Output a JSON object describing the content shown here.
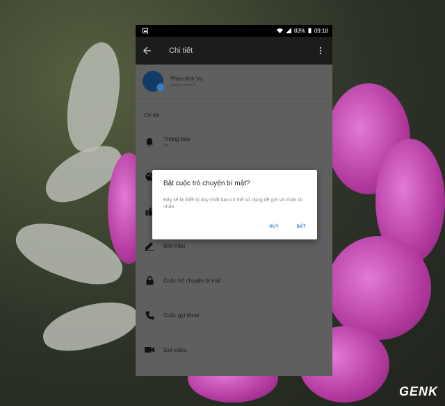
{
  "status_bar": {
    "battery": "83%",
    "time": "09:18"
  },
  "app_bar": {
    "title": "Chi tiết"
  },
  "profile": {
    "name": "Phan Anh Vu",
    "handle": "@phan.anhvu.3"
  },
  "settings": {
    "section_title": "Cài đặt",
    "items": [
      {
        "label": "Thông báo",
        "sublabel": "Bật",
        "icon": "bell-icon"
      },
      {
        "label": "",
        "sublabel": "",
        "icon": "palette-icon"
      },
      {
        "label": "",
        "sublabel": "",
        "icon": "thumbs-up-icon"
      },
      {
        "label": "Biệt hiệu",
        "sublabel": "",
        "icon": "pencil-icon"
      },
      {
        "label": "Cuộc trò chuyện bí mật",
        "sublabel": "",
        "icon": "lock-icon"
      },
      {
        "label": "Cuộc gọi thoại",
        "sublabel": "",
        "icon": "phone-icon"
      },
      {
        "label": "Gọi video",
        "sublabel": "",
        "icon": "video-icon"
      }
    ]
  },
  "dialog": {
    "title": "Bật cuộc trò chuyện bí mật?",
    "message": "Đây sẽ là thiết bị duy nhất bạn có thể sử dụng để gửi và nhận tin nhắn.",
    "cancel_label": "HỦY",
    "confirm_label": "BẬT"
  },
  "watermark": {
    "text": "GENK"
  },
  "colors": {
    "accent": "#2a7fd8",
    "overlay_panel": "#5f5f5f",
    "appbar": "#1c1c1c"
  }
}
